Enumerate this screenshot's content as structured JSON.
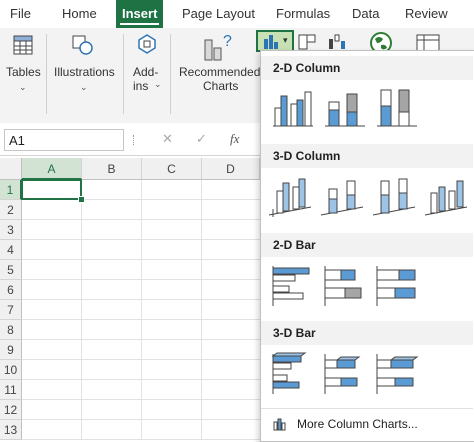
{
  "menu": {
    "tabs": [
      {
        "label": "File"
      },
      {
        "label": "Home"
      },
      {
        "label": "Insert",
        "active": true
      },
      {
        "label": "Page Layout"
      },
      {
        "label": "Formulas"
      },
      {
        "label": "Data"
      },
      {
        "label": "Review"
      }
    ]
  },
  "ribbon": {
    "tables_label": "Tables",
    "illustrations_label": "Illustrations",
    "addins_label_1": "Add-",
    "addins_label_2": "ins",
    "recommended_label_1": "Recommended",
    "recommended_label_2": "Charts"
  },
  "formula_bar": {
    "name_box": "A1",
    "cancel_glyph": "✕",
    "enter_glyph": "✓",
    "fx_glyph": "fx"
  },
  "grid": {
    "columns": [
      "A",
      "B",
      "C",
      "D"
    ],
    "rows": [
      "1",
      "2",
      "3",
      "4",
      "5",
      "6",
      "7",
      "8",
      "9",
      "10",
      "11",
      "12",
      "13"
    ]
  },
  "dropdown": {
    "sections": [
      {
        "title": "2-D Column",
        "items": [
          "Clustered Column",
          "Stacked Column",
          "100% Stacked Column"
        ]
      },
      {
        "title": "3-D Column",
        "items": [
          "3-D Clustered Column",
          "3-D Stacked Column",
          "3-D 100% Stacked Column",
          "3-D Column"
        ]
      },
      {
        "title": "2-D Bar",
        "items": [
          "Clustered Bar",
          "Stacked Bar",
          "100% Stacked Bar"
        ]
      },
      {
        "title": "3-D Bar",
        "items": [
          "3-D Clustered Bar",
          "3-D Stacked Bar",
          "3-D 100% Stacked Bar"
        ]
      }
    ],
    "more_label": "More Column Charts..."
  },
  "colors": {
    "excel_green": "#1f7244",
    "chart_blue": "#5b9bd5",
    "chart_blue_light": "#9dc3e6",
    "chart_gray": "#a5a5a5",
    "selection_green": "#217346"
  }
}
